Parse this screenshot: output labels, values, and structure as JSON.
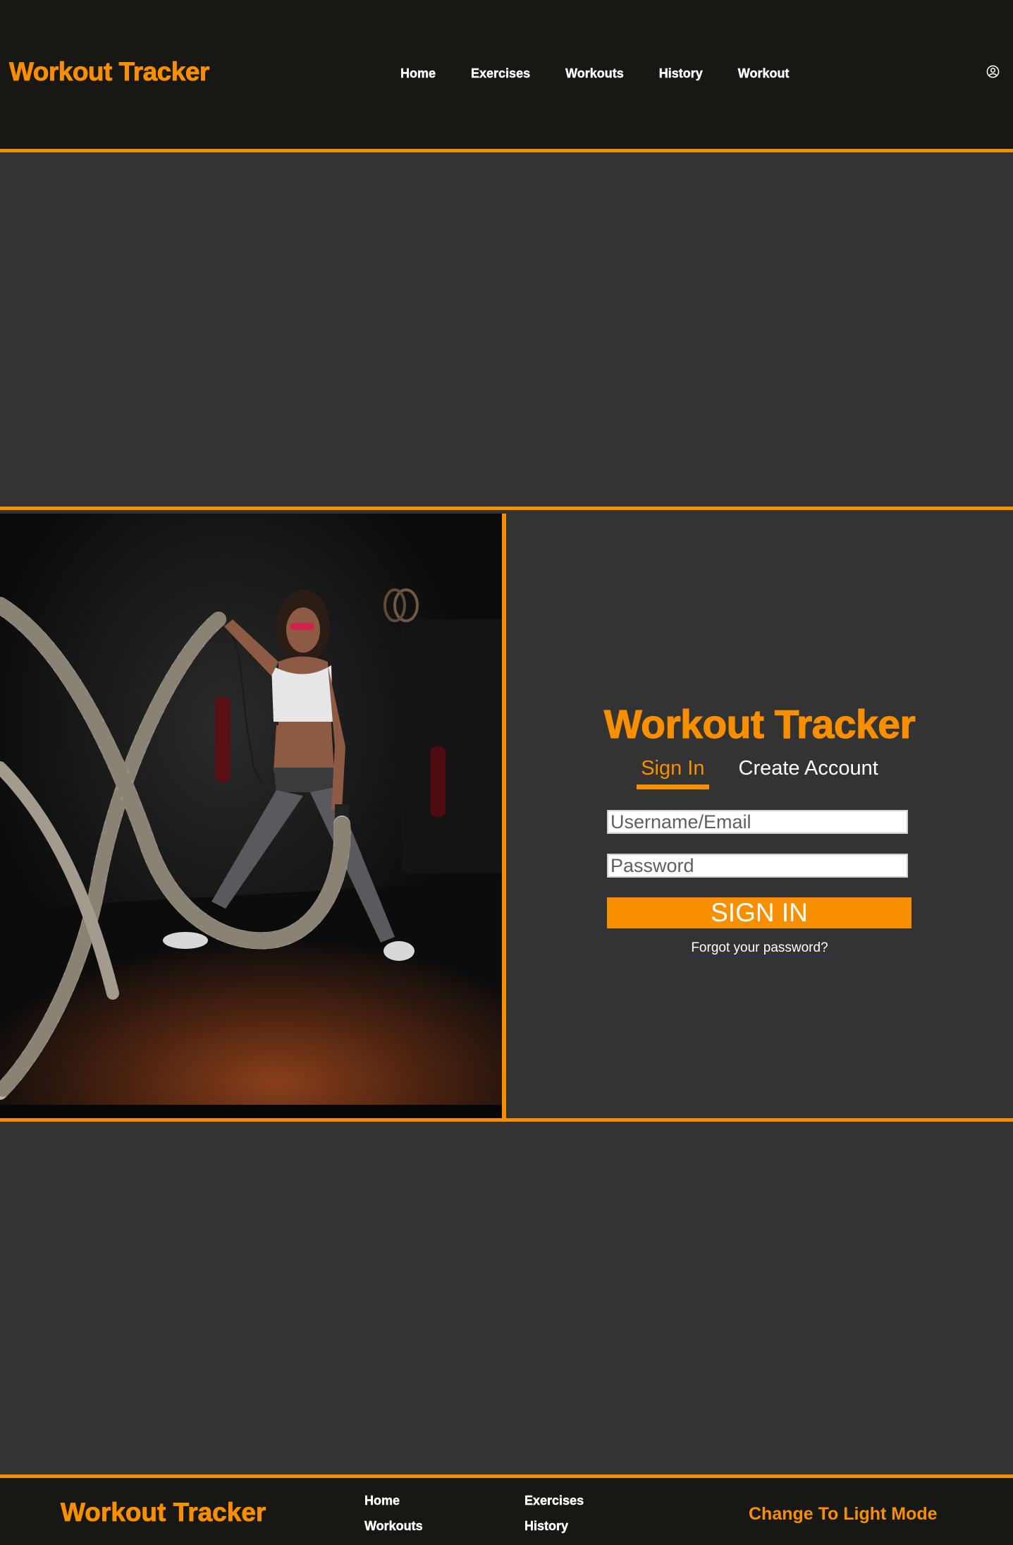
{
  "header": {
    "brand": "Workout Tracker",
    "nav": [
      "Home",
      "Exercises",
      "Workouts",
      "History",
      "Workout"
    ],
    "user_icon": "user-circle-icon"
  },
  "signin": {
    "title": "Workout Tracker",
    "tabs": [
      "Sign In",
      "Create Account"
    ],
    "active_tab": "Sign In",
    "username_placeholder": "Username/Email",
    "password_placeholder": "Password",
    "submit_label": "SIGN IN",
    "forgot_label": "Forgot your password?"
  },
  "footer": {
    "brand": "Workout Tracker",
    "links": [
      "Home",
      "Workouts",
      "Exercises",
      "History"
    ],
    "theme_toggle": "Change To Light Mode"
  },
  "colors": {
    "accent": "#f78f00",
    "header_bg": "#171714",
    "page_bg": "#323332"
  }
}
